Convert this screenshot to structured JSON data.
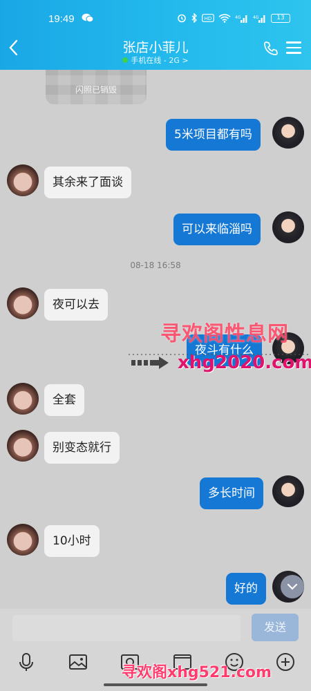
{
  "status_bar": {
    "time": "19:49",
    "battery": "13"
  },
  "header": {
    "title": "张店小菲儿",
    "subtitle": "手机在线 - 2G >",
    "back_icon": "back-chevron-icon",
    "phone_icon": "phone-icon",
    "menu_icon": "menu-icon"
  },
  "flash_photo": {
    "label": "闪照已销毁"
  },
  "messages": [
    {
      "side": "out",
      "text": "5米项目都有吗"
    },
    {
      "side": "in",
      "text": "其余来了面谈"
    },
    {
      "side": "out",
      "text": "可以来临淄吗"
    },
    {
      "side": "in",
      "text": "夜可以去"
    },
    {
      "side": "out",
      "text": "夜斗有什么"
    },
    {
      "side": "in",
      "text": "全套"
    },
    {
      "side": "in",
      "text": "别变态就行"
    },
    {
      "side": "out",
      "text": "多长时间"
    },
    {
      "side": "in",
      "text": "10小时"
    },
    {
      "side": "out",
      "text": "好的"
    }
  ],
  "timestamp": "08-18 16:58",
  "watermarks": {
    "top": "寻欢阁性息网",
    "mid": "xhg2020.com",
    "bottom": "寻欢阁xhg521.com"
  },
  "input": {
    "placeholder": "",
    "send_label": "发送"
  },
  "toolbar_icons": [
    "microphone-icon",
    "photo-icon",
    "image-icon",
    "camera-icon",
    "emoji-icon",
    "plus-icon"
  ]
}
